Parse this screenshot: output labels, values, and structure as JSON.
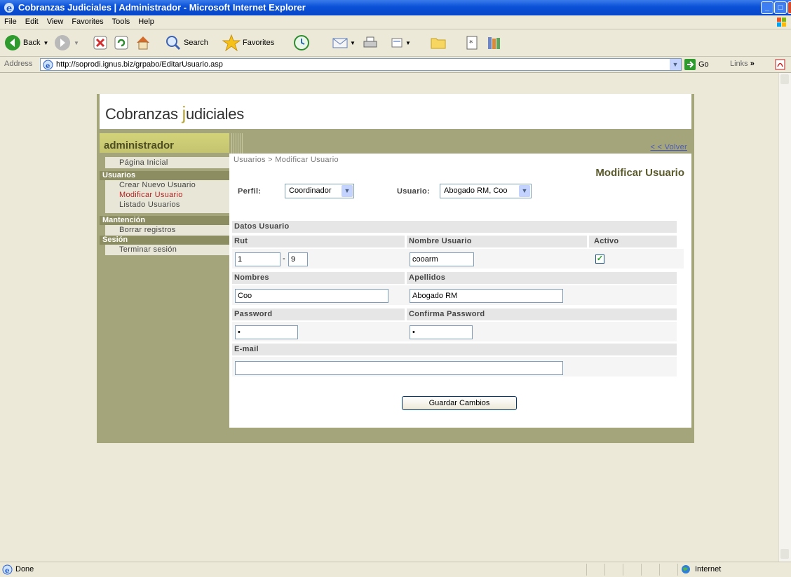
{
  "window": {
    "title": "Cobranzas Judiciales | Administrador - Microsoft Internet Explorer"
  },
  "menu": [
    "File",
    "Edit",
    "View",
    "Favorites",
    "Tools",
    "Help"
  ],
  "toolbar": {
    "back": "Back",
    "search": "Search",
    "favorites": "Favorites"
  },
  "address": {
    "label": "Address",
    "url": "http://soprodi.ignus.biz/grpabo/EditarUsuario.asp",
    "go": "Go",
    "links": "Links"
  },
  "site": {
    "logo_start": "Cobranzas ",
    "logo_j": "j",
    "logo_end": "udiciales",
    "admin_title": "administrador",
    "volver": "< < Volver"
  },
  "sidebar": {
    "home": "Página Inicial",
    "sections": [
      {
        "title": "Usuarios",
        "items": [
          {
            "label": "Crear Nuevo Usuario"
          },
          {
            "label": "Modificar Usuario"
          },
          {
            "label": "Listado Usuarios"
          }
        ]
      },
      {
        "title": "Mantención",
        "items": [
          {
            "label": "Borrar registros"
          }
        ]
      },
      {
        "title": "Sesión",
        "items": [
          {
            "label": "Terminar sesión"
          }
        ]
      }
    ]
  },
  "content": {
    "breadcrumb": "Usuarios >  Modificar Usuario",
    "title": "Modificar Usuario",
    "perfil_label": "Perfil:",
    "perfil_value": "Coordinador",
    "usuario_label": "Usuario:",
    "usuario_value": "Abogado RM, Coo",
    "section_title": "Datos Usuario",
    "fields": {
      "rut_label": "Rut",
      "rut_value": "1",
      "rut_sep": "-",
      "rut_dv": "9",
      "nombre_usuario_label": "Nombre Usuario",
      "nombre_usuario_value": "cooarm",
      "activo_label": "Activo",
      "nombres_label": "Nombres",
      "nombres_value": "Coo",
      "apellidos_label": "Apellidos",
      "apellidos_value": "Abogado RM",
      "password_label": "Password",
      "password_value": "•",
      "confirma_label": "Confirma Password",
      "confirma_value": "•",
      "email_label": "E-mail",
      "email_value": ""
    },
    "save_button": "Guardar Cambios"
  },
  "status": {
    "left": "Done",
    "zone": "Internet"
  },
  "colors": {
    "accent": "#a5a57c",
    "titlebar": "#0a50d8",
    "active_link": "#b42222"
  }
}
